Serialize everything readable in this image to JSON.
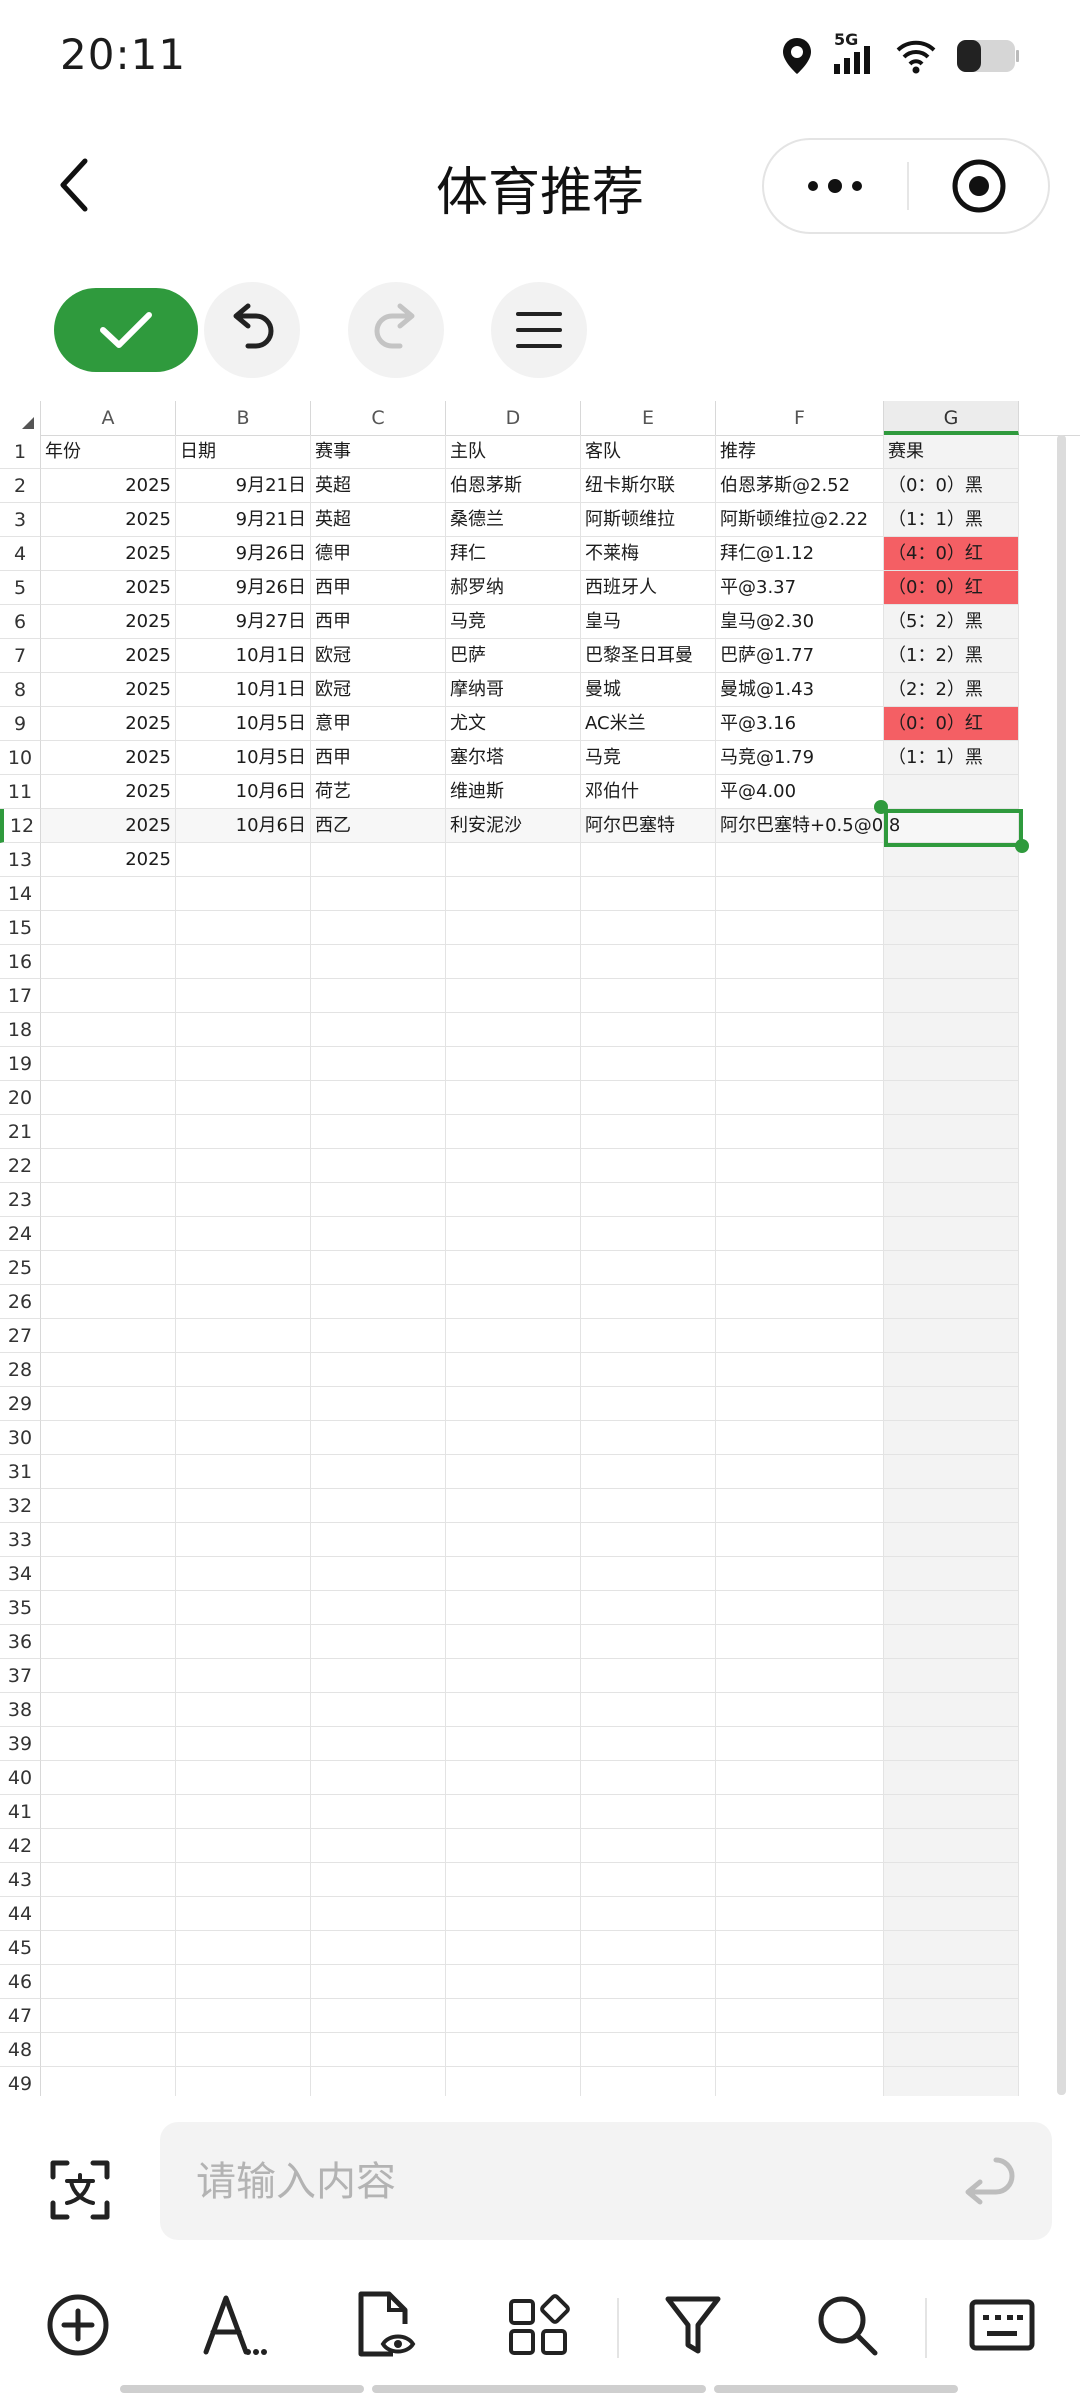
{
  "status_bar": {
    "time": "20:11",
    "network": "5G"
  },
  "nav": {
    "title": "体育推荐"
  },
  "input": {
    "placeholder": "请输入内容"
  },
  "sheet": {
    "selected_cell": "G12",
    "columns": [
      "A",
      "B",
      "C",
      "D",
      "E",
      "F",
      "G"
    ],
    "rows": [
      {
        "n": "1",
        "cells": [
          "年份",
          "日期",
          "赛事",
          "主队",
          "客队",
          "推荐",
          "赛果"
        ],
        "red": false
      },
      {
        "n": "2",
        "cells": [
          "2025",
          "9月21日",
          "英超",
          "伯恩茅斯",
          "纽卡斯尔联",
          "伯恩茅斯@2.52",
          "（0：0）黑"
        ],
        "red": false
      },
      {
        "n": "3",
        "cells": [
          "2025",
          "9月21日",
          "英超",
          "桑德兰",
          "阿斯顿维拉",
          "阿斯顿维拉@2.22",
          "（1：1）黑"
        ],
        "red": false
      },
      {
        "n": "4",
        "cells": [
          "2025",
          "9月26日",
          "德甲",
          "拜仁",
          "不莱梅",
          "拜仁@1.12",
          "（4：0）红"
        ],
        "red": true
      },
      {
        "n": "5",
        "cells": [
          "2025",
          "9月26日",
          "西甲",
          "郝罗纳",
          "西班牙人",
          "平@3.37",
          "（0：0）红"
        ],
        "red": true
      },
      {
        "n": "6",
        "cells": [
          "2025",
          "9月27日",
          "西甲",
          "马竞",
          "皇马",
          "皇马@2.30",
          "（5：2）黑"
        ],
        "red": false
      },
      {
        "n": "7",
        "cells": [
          "2025",
          "10月1日",
          "欧冠",
          "巴萨",
          "巴黎圣日耳曼",
          "巴萨@1.77",
          "（1：2）黑"
        ],
        "red": false
      },
      {
        "n": "8",
        "cells": [
          "2025",
          "10月1日",
          "欧冠",
          "摩纳哥",
          "曼城",
          "曼城@1.43",
          "（2：2）黑"
        ],
        "red": false
      },
      {
        "n": "9",
        "cells": [
          "2025",
          "10月5日",
          "意甲",
          "尤文",
          "AC米兰",
          "平@3.16",
          "（0：0）红"
        ],
        "red": true
      },
      {
        "n": "10",
        "cells": [
          "2025",
          "10月5日",
          "西甲",
          "塞尔塔",
          "马竞",
          "马竞@1.79",
          "（1：1）黑"
        ],
        "red": false
      },
      {
        "n": "11",
        "cells": [
          "2025",
          "10月6日",
          "荷艺",
          "维迪斯",
          "邓伯什",
          "平@4.00",
          ""
        ],
        "red": false
      },
      {
        "n": "12",
        "cells": [
          "2025",
          "10月6日",
          "西乙",
          "利安泥沙",
          "阿尔巴塞特",
          "阿尔巴塞特+0.5@0.8",
          ""
        ],
        "red": false
      },
      {
        "n": "13",
        "cells": [
          "2025",
          "",
          "",
          "",
          "",
          "",
          ""
        ],
        "red": false
      }
    ],
    "empty_row_numbers": [
      "14",
      "15",
      "16",
      "17",
      "18",
      "19",
      "20",
      "21",
      "22",
      "23",
      "24",
      "25",
      "26",
      "27",
      "28",
      "29",
      "30",
      "31",
      "32",
      "33",
      "34",
      "35",
      "36",
      "37",
      "38",
      "39",
      "40",
      "41",
      "42",
      "43",
      "44",
      "45",
      "46",
      "47",
      "48",
      "49"
    ]
  },
  "colors": {
    "accent": "#2f9a3d",
    "red_cell": "#f45f64"
  }
}
